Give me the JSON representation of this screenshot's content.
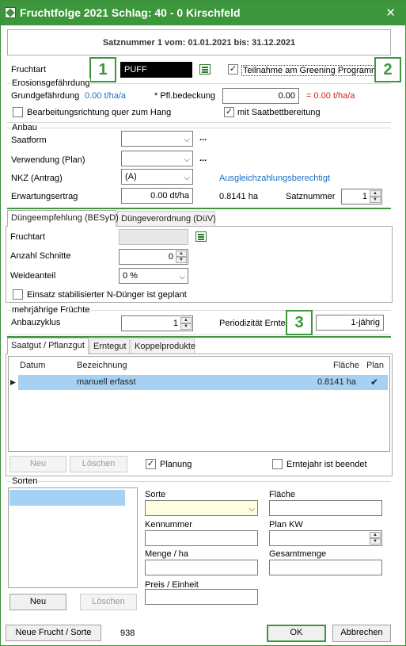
{
  "window": {
    "title": "Fruchtfolge 2021 Schlag: 40 - 0 Kirschfeld"
  },
  "header": {
    "text": "Satznummer 1 vom: 01.01.2021 bis: 31.12.2021"
  },
  "fruchtart": {
    "label": "Fruchtart",
    "value": "PUFF",
    "greening_label": "Teilnahme am Greening Programm"
  },
  "callouts": [
    "1",
    "2",
    "3"
  ],
  "erosion": {
    "legend": "Erosionsgefährdung",
    "grund_label": "Grundgefährdung",
    "grund_value": "0.00 t/ha/a",
    "pfl_label": "* Pfl.bedeckung",
    "pfl_value": "0.00",
    "result": "= 0.00 t/ha/a",
    "quer_label": "Bearbeitungsrichtung quer zum Hang",
    "saatbett_label": "mit Saatbettbereitung"
  },
  "anbau": {
    "legend": "Anbau",
    "saatform_label": "Saatform",
    "verwendung_label": "Verwendung (Plan)",
    "nkz_label": "NKZ  (Antrag)",
    "nkz_value": "(A)",
    "ausgleich": "Ausgleichzahlungsberechtigt",
    "ertrag_label": "Erwartungsertrag",
    "ertrag_value": "0.00 dt/ha",
    "area": "0.8141 ha",
    "satz_label": "Satznummer",
    "satz_value": "1",
    "ellipsis": "..."
  },
  "duenge": {
    "tabs": [
      "Düngeempfehlung (BESyD)",
      "Düngeverordnung (DüV)"
    ],
    "fruchtart_label": "Fruchtart",
    "schnitte_label": "Anzahl Schnitte",
    "schnitte_value": "0",
    "weide_label": "Weideanteil",
    "weide_value": "0 %",
    "stab_label": "Einsatz stabilisierter N-Dünger ist geplant"
  },
  "mehrj": {
    "legend": "mehrjährige Früchte",
    "zyklus_label": "Anbauzyklus",
    "zyklus_value": "1",
    "period_label": "Periodizität Ernte",
    "period_value": "1-jährig"
  },
  "saatgut": {
    "tabs": [
      "Saatgut / Pflanzgut",
      "Erntegut",
      "Koppelprodukte"
    ],
    "columns": [
      "Datum",
      "Bezeichnung",
      "Fläche",
      "Plan"
    ],
    "row": {
      "bezeichnung": "manuell erfasst",
      "flaeche": "0.8141 ha",
      "plan": "✔"
    },
    "neu": "Neu",
    "loeschen": "Löschen",
    "planung": "Planung",
    "erntejahr": "Erntejahr ist beendet"
  },
  "sorten": {
    "legend": "Sorten",
    "sorte_label": "Sorte",
    "flaeche_label": "Fläche",
    "kennnummer_label": "Kennummer",
    "plankw_label": "Plan KW",
    "menge_label": "Menge / ha",
    "gesamt_label": "Gesamtmenge",
    "preis_label": "Preis / Einheit",
    "neu": "Neu",
    "loeschen": "Löschen"
  },
  "footer": {
    "neue_frucht": "Neue Frucht / Sorte",
    "count": "938",
    "ok": "OK",
    "cancel": "Abbrechen"
  }
}
